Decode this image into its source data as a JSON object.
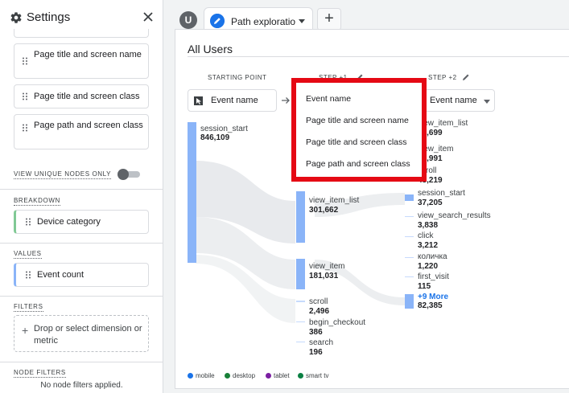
{
  "sidebar": {
    "title": "Settings",
    "step_items": [
      {
        "label": "Page title and screen name"
      },
      {
        "label": "Page title and screen class"
      },
      {
        "label": "Page path and screen class"
      }
    ],
    "unique_nodes_label": "VIEW UNIQUE NODES ONLY",
    "unique_nodes_on": false,
    "breakdown": {
      "label": "BREAKDOWN",
      "value": "Device category",
      "color": "#81c995"
    },
    "values": {
      "label": "VALUES",
      "value": "Event count",
      "color": "#8ab4f8"
    },
    "filters": {
      "label": "FILTERS",
      "placeholder": "Drop or select dimension or metric"
    },
    "node_filters": {
      "label": "NODE FILTERS",
      "message": "No node filters applied."
    }
  },
  "tabs": {
    "avatar_letter": "U",
    "items": [
      {
        "label": "Path exploration"
      }
    ],
    "add_label": "+"
  },
  "exploration": {
    "segment": "All Users",
    "columns": [
      {
        "header": "STARTING POINT",
        "dropdown": "Event name"
      },
      {
        "header": "STEP +1",
        "dropdown": "Event name"
      },
      {
        "header": "STEP +2",
        "dropdown": "Event name"
      }
    ],
    "starting_nodes": [
      {
        "label": "session_start",
        "value": "846,109"
      }
    ],
    "step1_nodes": [
      {
        "label": "view_item_list",
        "value": "301,662"
      },
      {
        "label": "view_item",
        "value": "181,031"
      },
      {
        "label": "scroll",
        "value": "2,496"
      },
      {
        "label": "begin_checkout",
        "value": "386"
      },
      {
        "label": "search",
        "value": "196"
      }
    ],
    "step2_nodes": [
      {
        "label": "view_item_list",
        "value": "75,699"
      },
      {
        "label": "view_item",
        "value": "74,991"
      },
      {
        "label": "scroll",
        "value": "43,219"
      },
      {
        "label": "session_start",
        "value": "37,205"
      },
      {
        "label": "view_search_results",
        "value": "3,838"
      },
      {
        "label": "click",
        "value": "3,212"
      },
      {
        "label": "количка",
        "value": "1,220"
      },
      {
        "label": "first_visit",
        "value": "115"
      },
      {
        "label": "+9 More",
        "value": "82,385"
      }
    ],
    "legend": [
      {
        "label": "mobile",
        "color": "#1a73e8"
      },
      {
        "label": "desktop",
        "color": "#188038"
      },
      {
        "label": "tablet",
        "color": "#7b1fa2"
      },
      {
        "label": "smart tv",
        "color": "#0b8043"
      }
    ]
  },
  "dropdown_menu": {
    "highlight_color": "#e50914",
    "items": [
      {
        "label": "Event name"
      },
      {
        "label": "Page title and screen name"
      },
      {
        "label": "Page title and screen class"
      },
      {
        "label": "Page path and screen class"
      }
    ]
  }
}
